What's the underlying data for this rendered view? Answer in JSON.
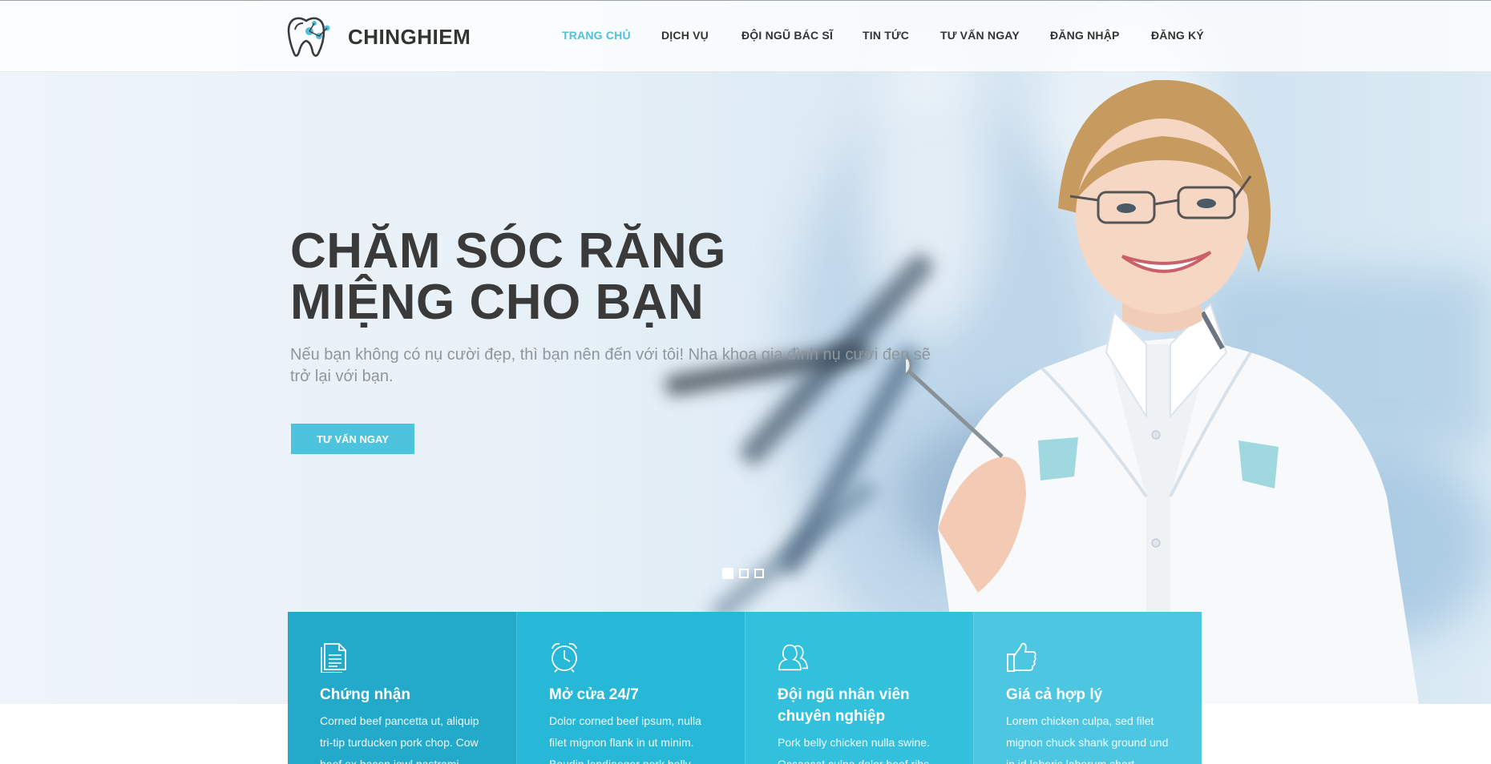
{
  "brand": {
    "name": "CHINGHIEM",
    "accent": "#4fc0d9",
    "logo_icon": "tooth-logo-icon"
  },
  "nav": {
    "items": [
      {
        "label": "TRANG CHỦ",
        "active": true
      },
      {
        "label": "DỊCH VỤ",
        "active": false
      },
      {
        "label": "ĐỘI NGŨ BÁC SĨ",
        "active": false
      },
      {
        "label": "TIN TỨC",
        "active": false
      },
      {
        "label": "TƯ VẤN NGAY",
        "active": false
      },
      {
        "label": "ĐĂNG NHẬP",
        "active": false
      },
      {
        "label": "ĐĂNG KÝ",
        "active": false
      }
    ]
  },
  "hero": {
    "title_line1": "CHĂM SÓC RĂNG",
    "title_line2": "MIỆNG CHO BẠN",
    "subtitle": "Nếu bạn không có nụ cười đẹp, thì bạn nên đến với tôi! Nha khoa gia đình nụ cười đẹp sẽ trở lại với bạn.",
    "cta_label": "TƯ VẤN NGAY",
    "slides_total": 3,
    "slide_active": 1
  },
  "features": [
    {
      "icon": "document-icon",
      "title": "Chứng nhận",
      "text": "Corned beef pancetta ut, aliquip tri-tip turducken pork chop. Cow beef ex bacon jowl pastrami",
      "color": "#23a9c9"
    },
    {
      "icon": "alarm-clock-icon",
      "title": "Mở cửa 24/7",
      "text": "Dolor corned beef ipsum, nulla filet mignon flank in ut minim. Boudin landjaeger pork belly",
      "color": "#27b8d8"
    },
    {
      "icon": "users-icon",
      "title": "Đội ngũ nhân viên chuyên nghiệp",
      "text": "Pork belly chicken nulla swine. Occaecat culpa dolor beef ribs",
      "color": "#33c0dd"
    },
    {
      "icon": "thumbs-up-icon",
      "title": "Giá cả hợp lý",
      "text": "Lorem chicken culpa, sed filet mignon chuck shank ground und in id laboris laborum short",
      "color": "#4cc6e1"
    }
  ]
}
